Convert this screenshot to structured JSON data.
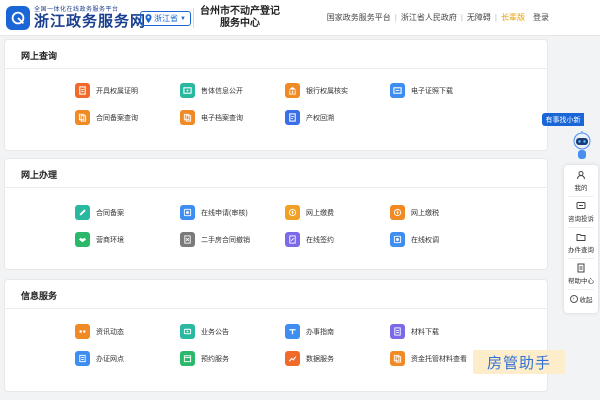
{
  "header": {
    "brand_sub": "全国一体化在线政务服务平台",
    "brand_main": "浙江政务服务网",
    "region": "浙江省",
    "center_title_line1": "台州市不动产登记",
    "center_title_line2": "服务中心",
    "nav": [
      "国家政务服务平台",
      "浙江省人民政府",
      "无障碍",
      "长辈版"
    ],
    "login": "登录"
  },
  "sections": [
    {
      "title": "网上查询",
      "items": [
        {
          "label": "开具权属证明",
          "color": "#f06a2a",
          "icon": "certificate-icon"
        },
        {
          "label": "售体信息公开",
          "color": "#2bb8a0",
          "icon": "info-icon"
        },
        {
          "label": "银行权属核实",
          "color": "#f08a24",
          "icon": "bank-icon"
        },
        {
          "label": "电子证照下载",
          "color": "#3d8ef0",
          "icon": "download-icon"
        },
        {
          "label": "合同备案查询",
          "color": "#f08a24",
          "icon": "contract-icon"
        },
        {
          "label": "电子档案查询",
          "color": "#f08a24",
          "icon": "archive-icon"
        },
        {
          "label": "产权回溯",
          "color": "#3a6fe8",
          "icon": "history-icon"
        }
      ]
    },
    {
      "title": "网上办理",
      "items": [
        {
          "label": "合同备案",
          "color": "#2bb8a0",
          "icon": "edit-icon"
        },
        {
          "label": "在线申请(审核)",
          "color": "#3d8ef0",
          "icon": "apply-icon"
        },
        {
          "label": "网上缴费",
          "color": "#f0a024",
          "icon": "pay-icon"
        },
        {
          "label": "网上缴税",
          "color": "#f08a24",
          "icon": "tax-icon"
        },
        {
          "label": "营商环境",
          "color": "#2bb86a",
          "icon": "handshake-icon"
        },
        {
          "label": "二手房合同撤销",
          "color": "#7a7a7a",
          "icon": "cancel-icon"
        },
        {
          "label": "在线签约",
          "color": "#7a6ae8",
          "icon": "sign-icon"
        },
        {
          "label": "在线权调",
          "color": "#3d8ef0",
          "icon": "adjust-icon"
        }
      ]
    },
    {
      "title": "信息服务",
      "items": [
        {
          "label": "资讯动态",
          "color": "#f08a24",
          "icon": "news-icon"
        },
        {
          "label": "业务公告",
          "color": "#2bb8a0",
          "icon": "announce-icon"
        },
        {
          "label": "办事指南",
          "color": "#3d8ef0",
          "icon": "guide-icon"
        },
        {
          "label": "材料下载",
          "color": "#7a6ae8",
          "icon": "material-icon"
        },
        {
          "label": "办证网点",
          "color": "#3d8ef0",
          "icon": "location-icon"
        },
        {
          "label": "预约服务",
          "color": "#2bb86a",
          "icon": "calendar-icon"
        },
        {
          "label": "数据服务",
          "color": "#f06a2a",
          "icon": "data-icon"
        },
        {
          "label": "资金托管材料查看",
          "color": "#f08a24",
          "icon": "fund-icon"
        }
      ]
    }
  ],
  "side": {
    "help_tag": "有事找小新",
    "buttons": [
      "我的",
      "咨询投诉",
      "办件查询",
      "帮助中心"
    ],
    "collapse": "收起"
  },
  "watermark": "房管助手"
}
